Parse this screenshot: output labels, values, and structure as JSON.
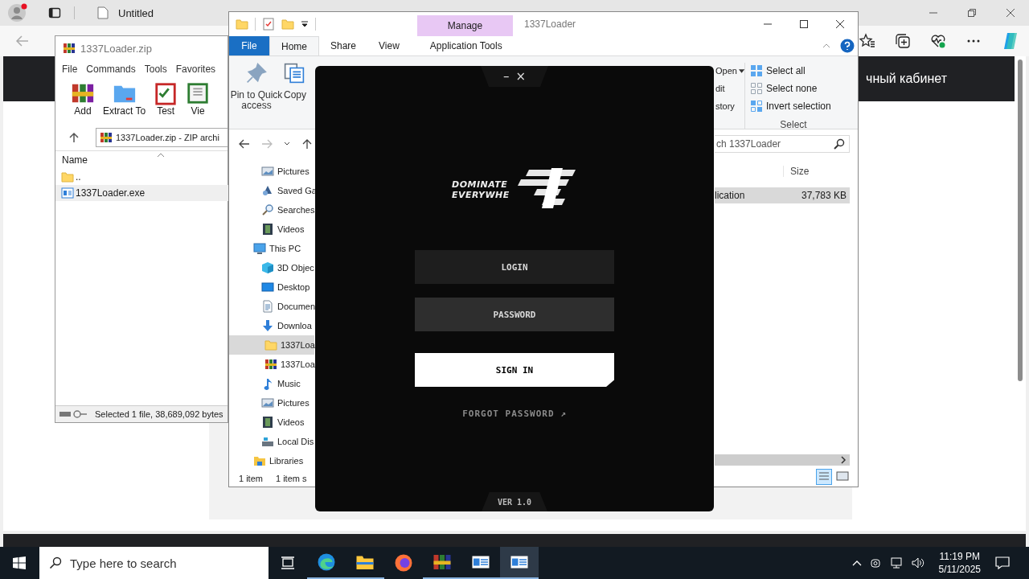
{
  "browser": {
    "tab": "Untitled",
    "page_header": "чный кабинет"
  },
  "winrar": {
    "title": "1337Loader.zip",
    "menu": [
      "File",
      "Commands",
      "Tools",
      "Favorites"
    ],
    "tools": [
      {
        "label": "Add",
        "kind": "add"
      },
      {
        "label": "Extract To",
        "kind": "extract"
      },
      {
        "label": "Test",
        "kind": "test"
      },
      {
        "label": "Vie",
        "kind": "view"
      }
    ],
    "path": "1337Loader.zip - ZIP archi",
    "column": "Name",
    "files": [
      {
        "name": "..",
        "kind": "folder",
        "selected": false
      },
      {
        "name": "1337Loader.exe",
        "kind": "exe",
        "selected": true
      }
    ],
    "status": "Selected 1 file, 38,689,092 bytes"
  },
  "explorer": {
    "title": "1337Loader",
    "context_group": "Manage",
    "file_tab": "File",
    "tabs": [
      {
        "label": "Home",
        "selected": true
      },
      {
        "label": "Share",
        "selected": false
      },
      {
        "label": "View",
        "selected": false
      },
      {
        "label": "Application Tools",
        "selected": false
      }
    ],
    "clipboard": [
      {
        "label": "Pin to Quick access",
        "kind": "pin"
      },
      {
        "label": "Copy",
        "kind": "copy"
      }
    ],
    "open_items": [
      "Open",
      "dit",
      "story"
    ],
    "select_items": [
      {
        "label": "Select all",
        "kind": "all"
      },
      {
        "label": "Select none",
        "kind": "none"
      },
      {
        "label": "Invert selection",
        "kind": "invert"
      }
    ],
    "select_group": "Select",
    "search": {
      "placeholder": "ch 1337Loader"
    },
    "nav_folders": [
      {
        "label": "Pictures",
        "kind": "pictures",
        "selected": false
      },
      {
        "label": "Saved Ga",
        "kind": "games",
        "selected": false
      },
      {
        "label": "Searches",
        "kind": "searches",
        "selected": false
      },
      {
        "label": "Videos",
        "kind": "videos",
        "selected": false
      }
    ],
    "nav_tree": [
      {
        "label": "This PC",
        "kind": "computer",
        "selected": false,
        "children": [
          {
            "label": "3D Objec",
            "kind": "objects",
            "selected": false
          },
          {
            "label": "Desktop",
            "kind": "desktop",
            "selected": false
          },
          {
            "label": "Documen",
            "kind": "documents",
            "selected": false
          },
          {
            "label": "Downloa",
            "kind": "downloads",
            "selected": false,
            "children": [
              {
                "label": "1337Loa",
                "kind": "folder",
                "selected": true
              },
              {
                "label": "1337Loa",
                "kind": "archive",
                "selected": false
              }
            ]
          },
          {
            "label": "Music",
            "kind": "music",
            "selected": false
          },
          {
            "label": "Pictures",
            "kind": "pictures",
            "selected": false
          },
          {
            "label": "Videos",
            "kind": "videos",
            "selected": false
          },
          {
            "label": "Local Dis",
            "kind": "drive",
            "selected": false
          }
        ]
      },
      {
        "label": "Libraries",
        "kind": "libraries",
        "selected": false
      }
    ],
    "columns": [
      "Size"
    ],
    "rows": [
      {
        "cells": [
          "lication",
          "37,783 KB"
        ],
        "selected": true
      }
    ],
    "status": [
      "1 item",
      "1 item s"
    ]
  },
  "loader": {
    "window_buttons": [
      "–",
      "×"
    ],
    "logo": [
      "DOMINATE",
      "EVERYWHE"
    ],
    "fields": [
      {
        "placeholder": "LOGIN",
        "focused": false
      },
      {
        "placeholder": "PASSWORD",
        "focused": true
      }
    ],
    "sign_in": "SIGN IN",
    "forgot": "FORGOT PASSWORD",
    "forgot_icon": "↗",
    "version": "VER 1.0"
  },
  "taskbar": {
    "search": {
      "placeholder": "Type here to search"
    },
    "apps": [
      {
        "kind": "edge",
        "running": true,
        "selected": false
      },
      {
        "kind": "files",
        "running": true,
        "selected": false
      },
      {
        "kind": "firefox",
        "running": false,
        "selected": false
      },
      {
        "kind": "winrar",
        "running": true,
        "selected": false
      },
      {
        "kind": "window",
        "running": true,
        "selected": false
      },
      {
        "kind": "window",
        "running": true,
        "selected": true
      }
    ],
    "time": "11:19 PM",
    "date": "5/11/2025"
  }
}
